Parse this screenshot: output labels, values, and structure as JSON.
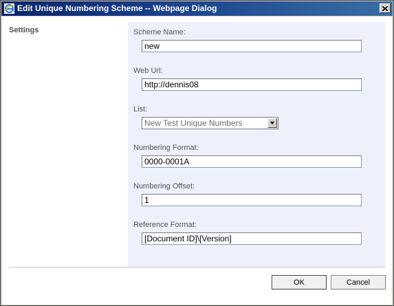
{
  "window": {
    "title": "Edit Unique Numbering Scheme -- Webpage Dialog",
    "icon": "ie-icon",
    "close_icon": "close-icon"
  },
  "section": {
    "label": "Settings"
  },
  "form": {
    "scheme_name_label": "Scheme Name:",
    "scheme_name_value": "new",
    "web_url_label": "Web Url:",
    "web_url_value": "http://dennis08",
    "list_label": "List:",
    "list_value": "New Test Unique Numbers",
    "numbering_format_label": "Numbering Format:",
    "numbering_format_value": "0000-0001A",
    "numbering_offset_label": "Numbering Offset:",
    "numbering_offset_value": "1",
    "reference_format_label": "Reference Format:",
    "reference_format_value": "[Document ID]\\[Version]"
  },
  "buttons": {
    "ok_label": "OK",
    "cancel_label": "Cancel"
  },
  "colors": {
    "title_bar": "#0a246a",
    "form_panel_bg": "#eef1fb",
    "label_text": "#525252"
  }
}
